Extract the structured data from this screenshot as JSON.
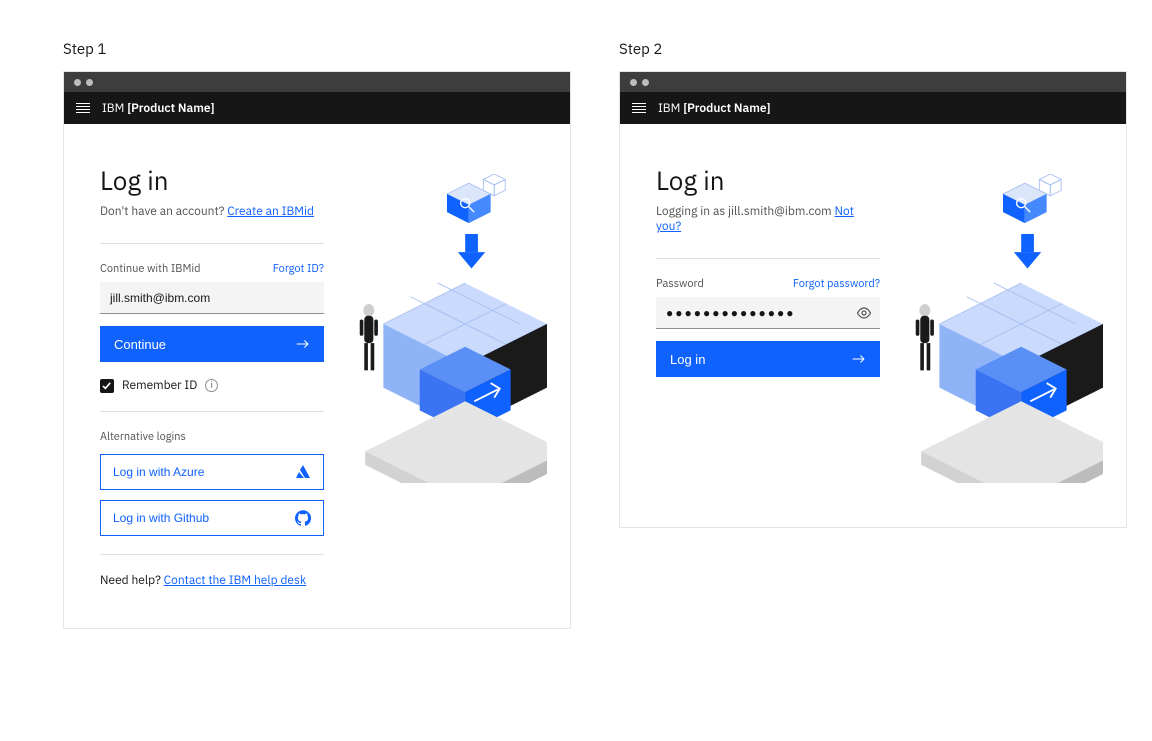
{
  "step1_label": "Step 1",
  "step2_label": "Step 2",
  "brand_prefix": "IBM ",
  "brand_name": "[Product Name]",
  "login_title": "Log in",
  "step1": {
    "sub_prefix": "Don't have an account? ",
    "sub_link": "Create an IBMid",
    "field_label": "Continue with IBMid",
    "forgot_link": "Forgot ID?",
    "email_value": "jill.smith@ibm.com",
    "continue_label": "Continue",
    "remember_label": "Remember ID",
    "alt_heading": "Alternative logins",
    "alt_azure": "Log in with Azure",
    "alt_github": "Log in with Github",
    "help_prefix": "Need help? ",
    "help_link": "Contact the IBM help desk"
  },
  "step2": {
    "sub_prefix": "Logging in as jill.smith@ibm.com ",
    "sub_link": "Not you?",
    "field_label": "Password",
    "forgot_link": "Forgot password?",
    "password_value": "●●●●●●●●●●●●●●",
    "login_label": "Log in"
  }
}
